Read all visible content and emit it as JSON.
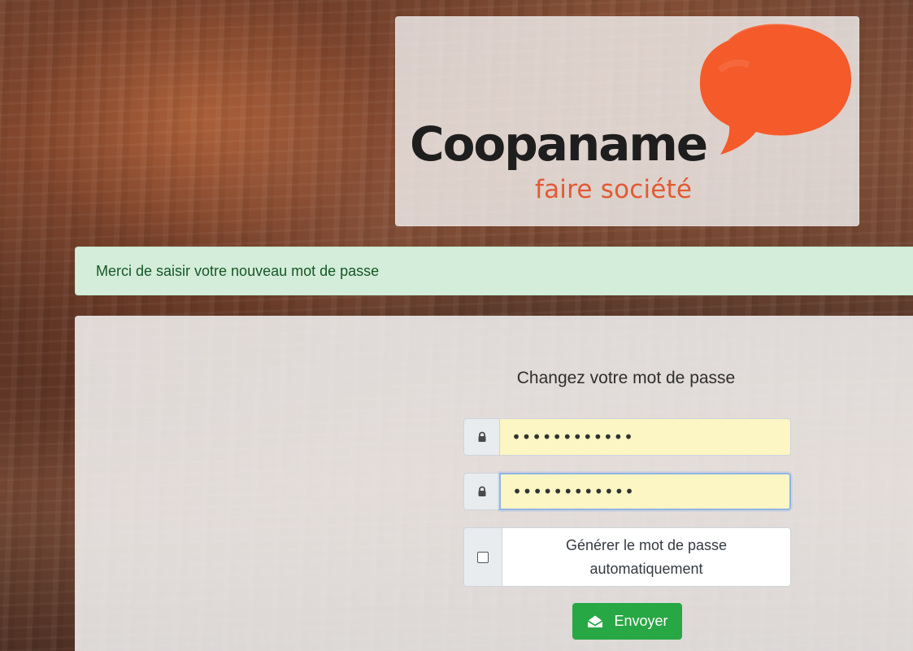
{
  "brand": {
    "name": "Coopaname",
    "tagline": "faire société",
    "bubble_color": "#f45a2a"
  },
  "alert": {
    "message": "Merci de saisir votre nouveau mot de passe",
    "type": "success"
  },
  "form": {
    "title": "Changez votre mot de passe",
    "password": {
      "icon": "lock-icon",
      "masked_value": "••••••••••••"
    },
    "confirm_password": {
      "icon": "lock-icon",
      "masked_value": "••••••••••••"
    },
    "generate_checkbox": {
      "checked": false,
      "label": "Générer le mot de passe automatiquement"
    },
    "submit": {
      "icon": "envelope-open-icon",
      "label": "Envoyer"
    }
  },
  "colors": {
    "accent": "#28a745",
    "alert_bg": "#d4edda",
    "alert_text": "#155724",
    "logo_orange": "#e25a32"
  }
}
